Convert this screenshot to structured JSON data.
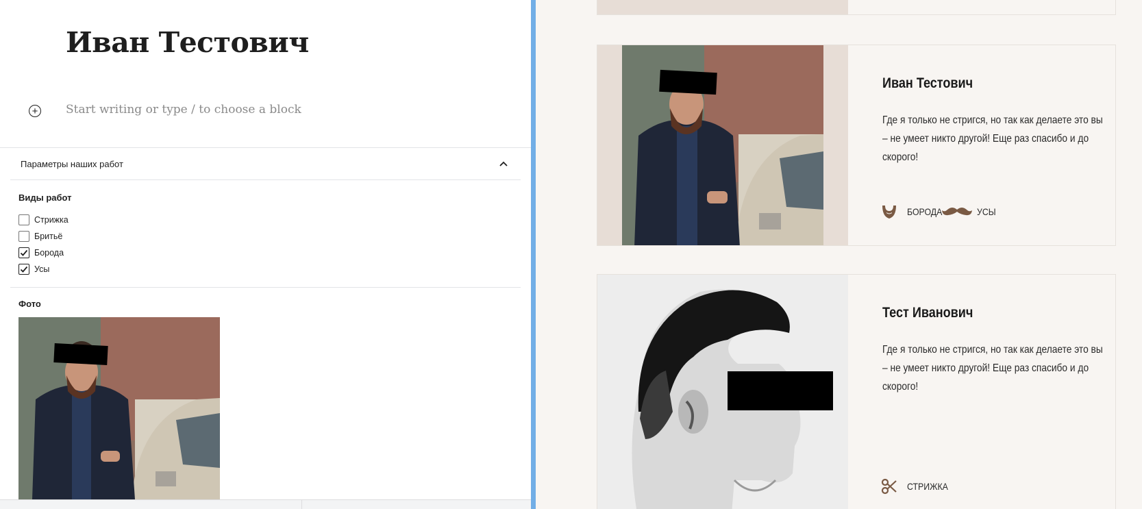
{
  "editor": {
    "post_title": "Иван Тестович",
    "block_placeholder": "Start writing or type / to choose a block",
    "panel": {
      "title": "Параметры наших работ",
      "work_types_label": "Виды работ",
      "options": [
        {
          "label": "Стрижка",
          "checked": false
        },
        {
          "label": "Бритьё",
          "checked": false
        },
        {
          "label": "Борода",
          "checked": true
        },
        {
          "label": "Усы",
          "checked": true
        }
      ],
      "photo_label": "Фото"
    }
  },
  "preview": {
    "cards": [
      {
        "name": "Иван Тестович",
        "text": "Где я только не стригся, но так как делаете это вы – не умеет никто другой! Еще раз спасибо и до скорого!",
        "tags": [
          {
            "icon": "beard-icon",
            "label": "БОРОДА"
          },
          {
            "icon": "mustache-icon",
            "label": "УСЫ"
          }
        ]
      },
      {
        "name": "Тест Иванович",
        "text": "Где я только не стригся, но так как делаете это вы – не умеет никто другой! Еще раз спасибо и до скорого!",
        "tags": [
          {
            "icon": "scissors-icon",
            "label": "СТРИЖКА"
          }
        ]
      }
    ]
  },
  "colors": {
    "accent_divider": "#72aee6",
    "checkbox_checked": "#1e1e1e",
    "preview_background": "#f8f5f2",
    "icon_brown": "#7a5a44"
  }
}
